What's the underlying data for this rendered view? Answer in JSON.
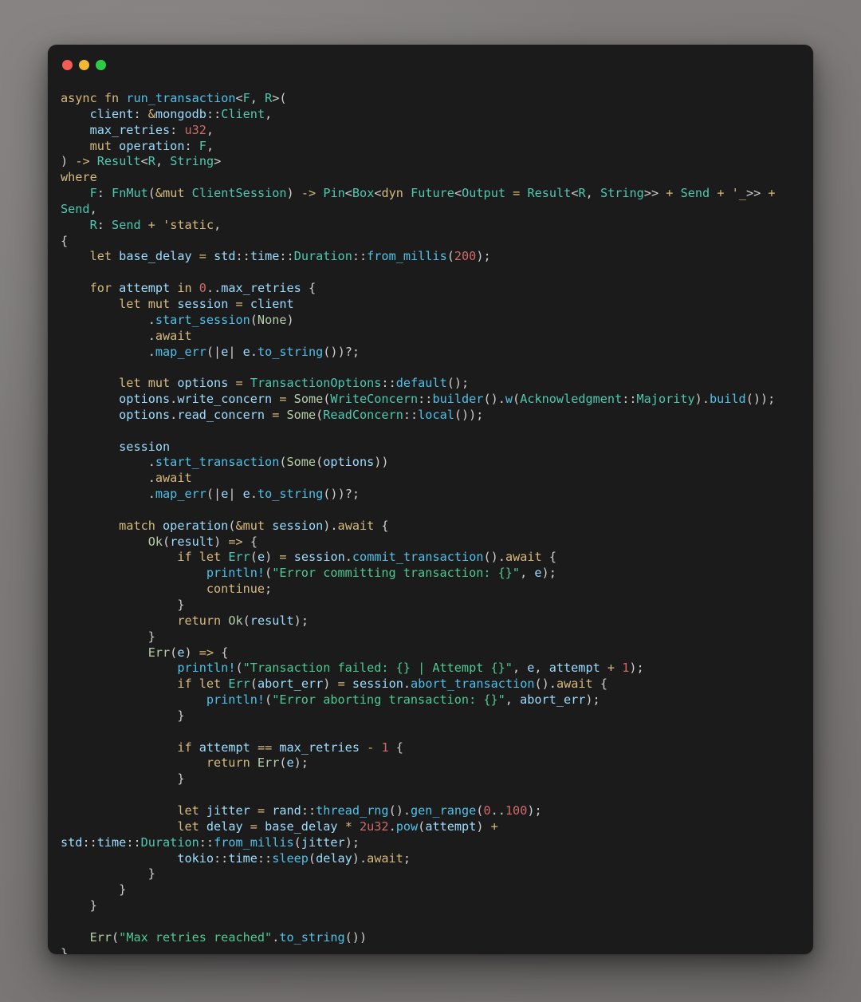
{
  "window": {
    "app": "code-snippet-viewer",
    "traffic_lights": [
      {
        "name": "close",
        "color": "#f25c54"
      },
      {
        "name": "minimize",
        "color": "#f2b733"
      },
      {
        "name": "maximize",
        "color": "#2ecb45"
      }
    ],
    "background_color": "#1b1b1b",
    "page_background_color": "#7f7b7b"
  },
  "editor": {
    "language": "rust",
    "theme_colors": {
      "background": "#1b1b1b",
      "foreground": "#d4d4d4",
      "keyword": "#d7ba7d",
      "type": "#4ec9b0",
      "identifier": "#9cdcfe",
      "function": "#4fc1e9",
      "number": "#d16969",
      "string": "#4ec994",
      "enum_variant": "#b5cea8",
      "punctuation": "#cfcfcf"
    },
    "code_lines": [
      "async fn run_transaction<F, R>(",
      "    client: &mongodb::Client,",
      "    max_retries: u32,",
      "    mut operation: F,",
      ") -> Result<R, String>",
      "where",
      "    F: FnMut(&mut ClientSession) -> Pin<Box<dyn Future<Output = Result<R, String>> + Send + '_>> + Send,",
      "    R: Send + 'static,",
      "{",
      "    let base_delay = std::time::Duration::from_millis(200);",
      "",
      "    for attempt in 0..max_retries {",
      "        let mut session = client",
      "            .start_session(None)",
      "            .await",
      "            .map_err(|e| e.to_string())?;",
      "",
      "        let mut options = TransactionOptions::default();",
      "        options.write_concern = Some(WriteConcern::builder().w(Acknowledgment::Majority).build());",
      "        options.read_concern = Some(ReadConcern::local());",
      "",
      "        session",
      "            .start_transaction(Some(options))",
      "            .await",
      "            .map_err(|e| e.to_string())?;",
      "",
      "        match operation(&mut session).await {",
      "            Ok(result) => {",
      "                if let Err(e) = session.commit_transaction().await {",
      "                    println!(\"Error committing transaction: {}\", e);",
      "                    continue;",
      "                }",
      "                return Ok(result);",
      "            }",
      "            Err(e) => {",
      "                println!(\"Transaction failed: {} | Attempt {}\", e, attempt + 1);",
      "                if let Err(abort_err) = session.abort_transaction().await {",
      "                    println!(\"Error aborting transaction: {}\", abort_err);",
      "                }",
      "",
      "                if attempt == max_retries - 1 {",
      "                    return Err(e);",
      "                }",
      "",
      "                let jitter = rand::thread_rng().gen_range(0..100);",
      "                let delay = base_delay * 2u32.pow(attempt) + std::time::Duration::from_millis(jitter);",
      "                tokio::time::sleep(delay).await;",
      "            }",
      "        }",
      "    }",
      "",
      "    Err(\"Max retries reached\".to_string())",
      "}"
    ],
    "strings": [
      "Error committing transaction: {}",
      "Transaction failed: {} | Attempt {}",
      "Error aborting transaction: {}",
      "Max retries reached"
    ],
    "numbers": [
      "200",
      "0",
      "100",
      "1",
      "2u32",
      "u32"
    ],
    "function_name": "run_transaction"
  }
}
